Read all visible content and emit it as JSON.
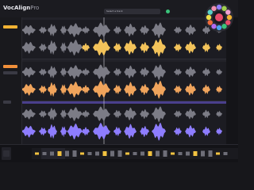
{
  "app": {
    "name_bold": "VocAlign",
    "name_light": "Pro"
  },
  "header": {
    "file_label": "Select a track"
  },
  "colors": {
    "bg": "#17171b",
    "track1": "#f3c35a",
    "track2": "#f0a45c",
    "track3": "#8e7dff",
    "guide": "#7c7c86",
    "accent": "#f2b233",
    "status_ok": "#3ac37a"
  },
  "sidebar": {
    "buttons": [
      {
        "name": "track-1-button",
        "color": "#f2b233"
      },
      {
        "name": "track-2-button",
        "color": "#f08f3a"
      },
      {
        "name": "track-3-button",
        "color": "#3a3a44"
      }
    ]
  },
  "tracks": [
    {
      "name": "track-1",
      "color": "#f3c35a"
    },
    {
      "name": "track-2",
      "color": "#f0a45c"
    },
    {
      "name": "track-3",
      "color": "#8e7dff"
    }
  ]
}
